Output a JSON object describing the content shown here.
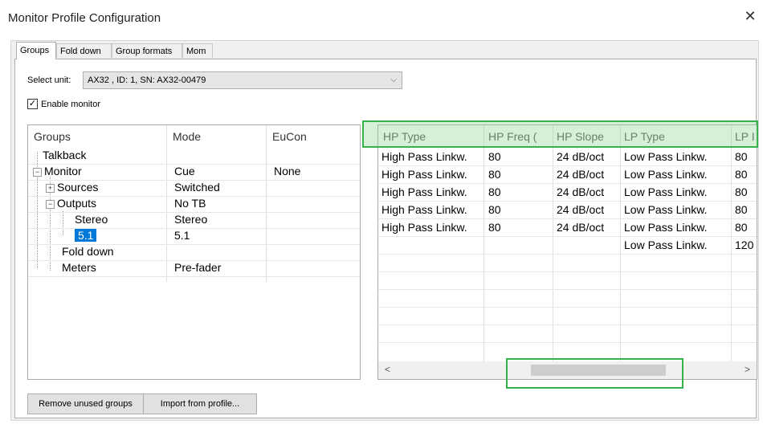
{
  "window": {
    "title": "Monitor Profile Configuration",
    "close_glyph": "✕"
  },
  "tabs": [
    {
      "label": "Groups",
      "active": true
    },
    {
      "label": "Fold down",
      "active": false
    },
    {
      "label": "Group formats",
      "active": false
    },
    {
      "label": "Mom",
      "active": false
    }
  ],
  "unit": {
    "label": "Select unit:",
    "value": "AX32 , ID: 1, SN: AX32-00479",
    "arrow": "⌵"
  },
  "enable_monitor": {
    "label": "Enable monitor",
    "checked": true,
    "mark": "✓"
  },
  "tree": {
    "columns": [
      "Groups",
      "Mode",
      "EuCon"
    ],
    "rows": [
      {
        "name": "Talkback",
        "mode": "",
        "eucon": ""
      },
      {
        "name": "Monitor",
        "mode": "Cue",
        "eucon": "None",
        "expander": "−"
      },
      {
        "name": "Sources",
        "mode": "Switched",
        "eucon": "",
        "expander": "+"
      },
      {
        "name": "Outputs",
        "mode": "No TB",
        "eucon": "",
        "expander": "−"
      },
      {
        "name": "Stereo",
        "mode": "Stereo",
        "eucon": ""
      },
      {
        "name": "5.1",
        "mode": "5.1",
        "eucon": "",
        "selected": true
      },
      {
        "name": "Fold down",
        "mode": "",
        "eucon": ""
      },
      {
        "name": "Meters",
        "mode": "Pre-fader",
        "eucon": ""
      }
    ]
  },
  "grid": {
    "columns": [
      "HP Type",
      "HP Freq (",
      "HP Slope",
      "LP Type",
      "LP I"
    ],
    "rows": [
      [
        "High Pass Linkw.",
        "80",
        "24 dB/oct",
        "Low Pass Linkw.",
        "80"
      ],
      [
        "High Pass Linkw.",
        "80",
        "24 dB/oct",
        "Low Pass Linkw.",
        "80"
      ],
      [
        "High Pass Linkw.",
        "80",
        "24 dB/oct",
        "Low Pass Linkw.",
        "80"
      ],
      [
        "High Pass Linkw.",
        "80",
        "24 dB/oct",
        "Low Pass Linkw.",
        "80"
      ],
      [
        "High Pass Linkw.",
        "80",
        "24 dB/oct",
        "Low Pass Linkw.",
        "80"
      ],
      [
        "",
        "",
        "",
        "Low Pass Linkw.",
        "120"
      ]
    ],
    "scroll_left": "<",
    "scroll_right": ">"
  },
  "buttons": {
    "remove": "Remove unused groups",
    "import": "Import from profile..."
  },
  "colors": {
    "selection": "#0078d7",
    "highlight": "#35b24a"
  }
}
